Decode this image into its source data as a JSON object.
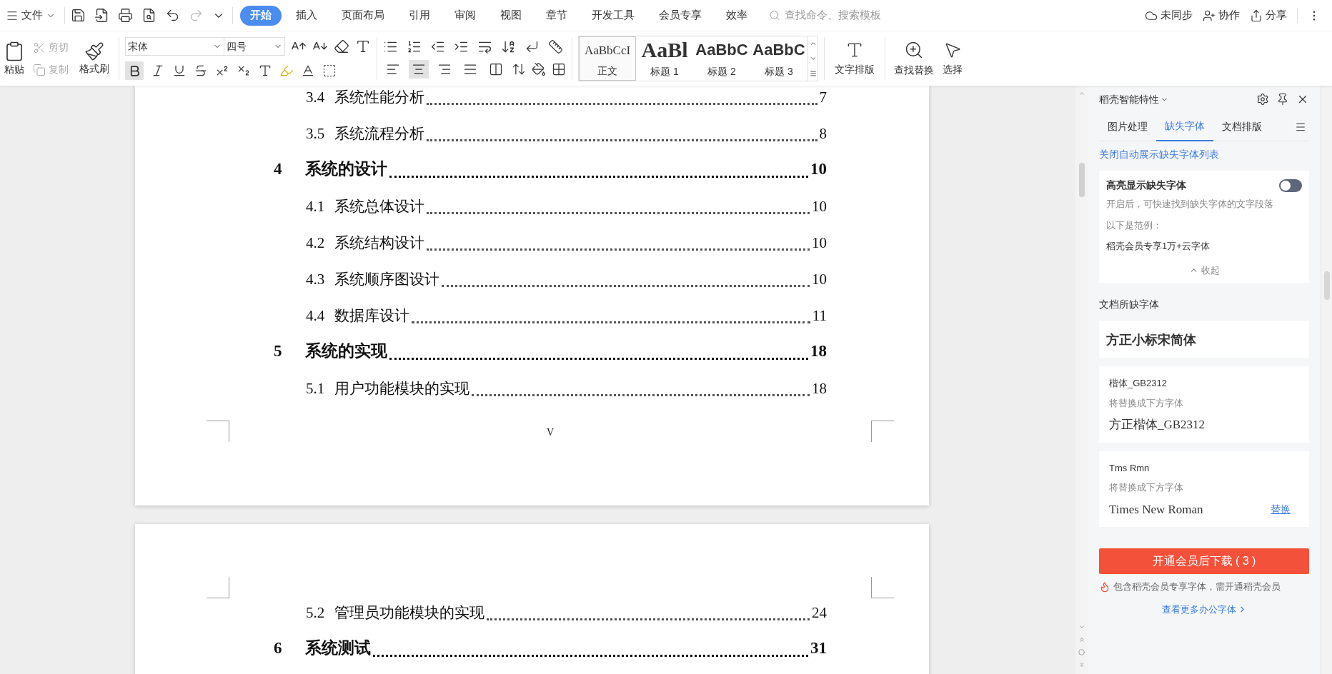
{
  "menu": {
    "file": "文件"
  },
  "tabs": [
    {
      "label": "开始",
      "selected": true
    },
    {
      "label": "插入",
      "selected": false
    },
    {
      "label": "页面布局",
      "selected": false
    },
    {
      "label": "引用",
      "selected": false
    },
    {
      "label": "审阅",
      "selected": false
    },
    {
      "label": "视图",
      "selected": false
    },
    {
      "label": "章节",
      "selected": false
    },
    {
      "label": "开发工具",
      "selected": false
    },
    {
      "label": "会员专享",
      "selected": false
    },
    {
      "label": "效率",
      "selected": false
    }
  ],
  "search": {
    "placeholder": "查找命令、搜索模板"
  },
  "top_actions": [
    {
      "kind": "sync",
      "label": "未同步"
    },
    {
      "kind": "collab",
      "label": "协作"
    },
    {
      "kind": "share",
      "label": "分享"
    }
  ],
  "ribbon": {
    "clipboard": {
      "paste": "粘贴",
      "cut": "剪切",
      "copy": "复制",
      "format_painter": "格式刷"
    },
    "font": {
      "name": "宋体",
      "size": "四号",
      "bold_on": true
    },
    "alignments": [
      {
        "kind": "left",
        "selected": false
      },
      {
        "kind": "center",
        "selected": true
      },
      {
        "kind": "right",
        "selected": false
      },
      {
        "kind": "justify",
        "selected": false
      },
      {
        "kind": "distributed",
        "selected": false
      }
    ],
    "styles": [
      {
        "kind": "body",
        "preview": "AaBbCcI",
        "label": "正文",
        "selected": true
      },
      {
        "kind": "h1",
        "preview": "AaBl",
        "label": "标题 1",
        "selected": false
      },
      {
        "kind": "h2",
        "preview": "AaBbC",
        "label": "标题 2",
        "selected": false
      },
      {
        "kind": "h3",
        "preview": "AaBbC",
        "label": "标题 3",
        "selected": false
      }
    ],
    "text_layout": "文字排版",
    "find_replace": "查找替换",
    "select": "选择"
  },
  "document": {
    "pages": [
      {
        "toc": [
          {
            "kind": "section",
            "number": "3.4",
            "title": "系统性能分析",
            "page": "7"
          },
          {
            "kind": "section",
            "number": "3.5",
            "title": "系统流程分析",
            "page": "8"
          },
          {
            "kind": "chapter",
            "number": "4",
            "title": "系统的设计",
            "page": "10"
          },
          {
            "kind": "section",
            "number": "4.1",
            "title": "系统总体设计",
            "page": "10"
          },
          {
            "kind": "section",
            "number": "4.2",
            "title": "系统结构设计",
            "page": "10"
          },
          {
            "kind": "section",
            "number": "4.3",
            "title": "系统顺序图设计",
            "page": "10"
          },
          {
            "kind": "section",
            "number": "4.4",
            "title": "数据库设计",
            "page": "11"
          },
          {
            "kind": "chapter",
            "number": "5",
            "title": "系统的实现",
            "page": "18"
          },
          {
            "kind": "section",
            "number": "5.1",
            "title": "用户功能模块的实现",
            "page": "18"
          }
        ],
        "page_number": "V"
      },
      {
        "toc": [
          {
            "kind": "section",
            "number": "5.2",
            "title": "管理员功能模块的实现",
            "page": "24"
          },
          {
            "kind": "chapter",
            "number": "6",
            "title": "系统测试",
            "page": "31"
          }
        ]
      }
    ]
  },
  "panel": {
    "title": "稻壳智能特性",
    "tabs": [
      {
        "label": "图片处理",
        "selected": false
      },
      {
        "label": "缺失字体",
        "selected": true
      },
      {
        "label": "文档排版",
        "selected": false
      }
    ],
    "link": "关闭自动展示缺失字体列表",
    "highlight": {
      "title": "高亮显示缺失字体",
      "on": false,
      "description": "开启后，可快速找到缺失字体的文字段落",
      "example_label": "以下是范例：",
      "example": "稻壳会员专享1万+云字体",
      "collapse": "收起"
    },
    "section_title": "文档所缺字体",
    "fonts": [
      {
        "kind": "single",
        "name": "方正小标宋简体"
      },
      {
        "kind": "replace",
        "name": "楷体_GB2312",
        "hint": "将替换成下方字体",
        "replacement": "方正楷体_GB2312"
      },
      {
        "kind": "replace",
        "name": "Tms Rmn",
        "hint": "将替换成下方字体",
        "replacement": "Times New Roman",
        "action": "替换"
      }
    ],
    "download_button": "开通会员后下载 ( 3 )",
    "notice": "包含稻壳会员专享字体，需开通稻壳会员",
    "more_link": "查看更多办公字体"
  }
}
